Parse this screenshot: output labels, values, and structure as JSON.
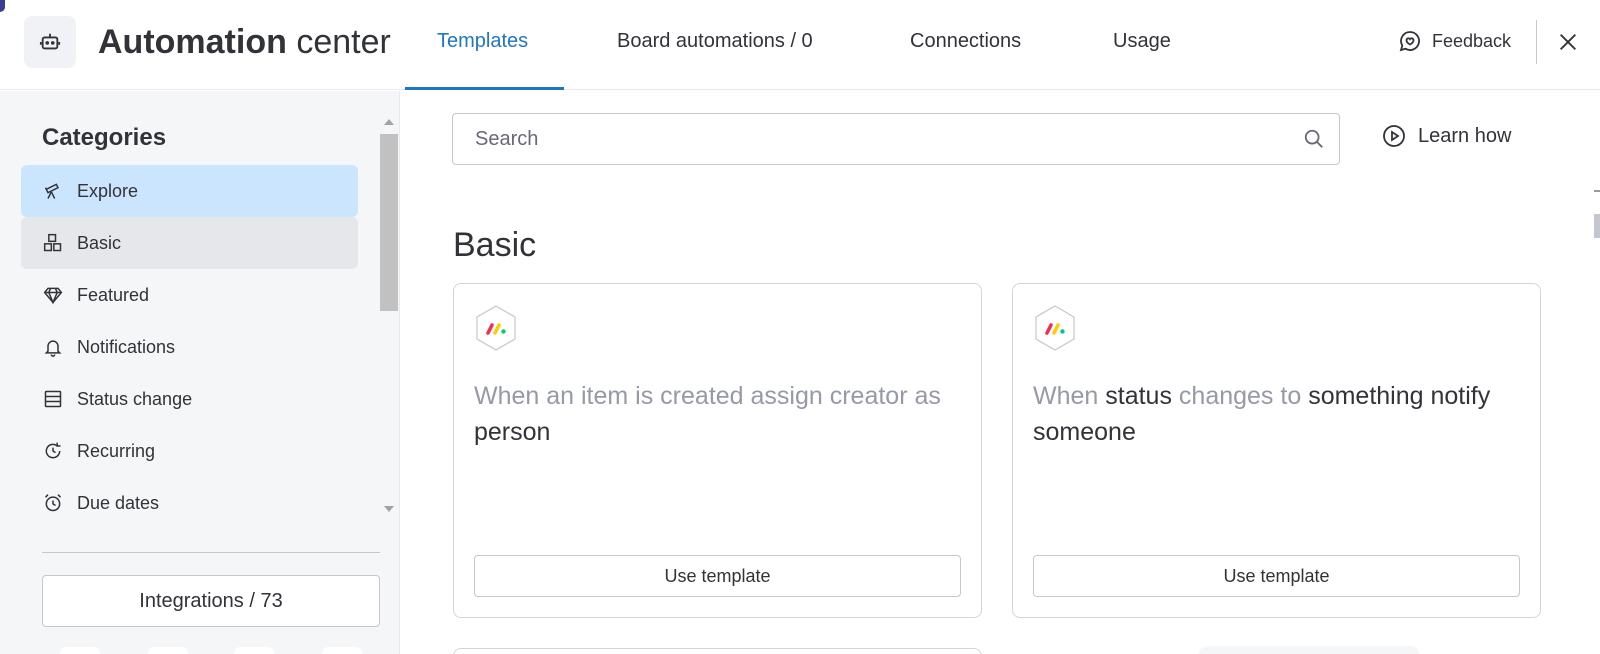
{
  "header": {
    "title_bold": "Automation",
    "title_light": "center",
    "tabs": [
      {
        "label": "Templates",
        "active": true
      },
      {
        "label": "Board automations / 0",
        "active": false
      },
      {
        "label": "Connections",
        "active": false
      },
      {
        "label": "Usage",
        "active": false
      }
    ],
    "feedback_label": "Feedback",
    "accent_color": "#1f76c2"
  },
  "sidebar": {
    "title": "Categories",
    "items": [
      {
        "label": "Explore",
        "icon": "telescope-icon",
        "state": "selected"
      },
      {
        "label": "Basic",
        "icon": "blocks-icon",
        "state": "hover"
      },
      {
        "label": "Featured",
        "icon": "diamond-icon",
        "state": "normal"
      },
      {
        "label": "Notifications",
        "icon": "bell-icon",
        "state": "normal"
      },
      {
        "label": "Status change",
        "icon": "status-list-icon",
        "state": "normal"
      },
      {
        "label": "Recurring",
        "icon": "recurring-clock-icon",
        "state": "normal"
      },
      {
        "label": "Due dates",
        "icon": "alarm-clock-icon",
        "state": "normal"
      }
    ],
    "integrations_label": "Integrations / 73",
    "selected_color": "#cce5ff"
  },
  "main": {
    "search": {
      "placeholder": "Search",
      "value": ""
    },
    "learn_how_label": "Learn how",
    "section_title": "Basic",
    "cards": [
      {
        "parts": [
          {
            "text": "When an item is created assign creator as ",
            "strong": false
          },
          {
            "text": "person",
            "strong": true
          }
        ],
        "button_label": "Use template"
      },
      {
        "parts": [
          {
            "text": "When ",
            "strong": false
          },
          {
            "text": "status",
            "strong": true
          },
          {
            "text": " changes to ",
            "strong": false
          },
          {
            "text": "something notify someone",
            "strong": true
          }
        ],
        "button_label": "Use template"
      }
    ]
  }
}
